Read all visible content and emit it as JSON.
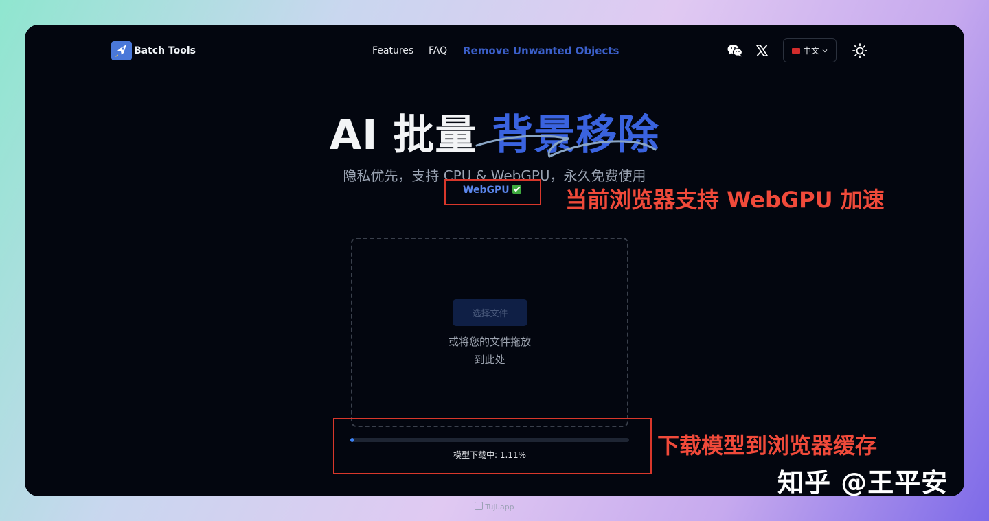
{
  "header": {
    "brand": "Batch Tools",
    "nav": [
      {
        "label": "Features"
      },
      {
        "label": "FAQ"
      },
      {
        "label": "Remove Unwanted Objects"
      }
    ],
    "language_label": "中文"
  },
  "hero": {
    "title_main": "AI 批量 ",
    "title_accent": "背景移除",
    "subtitle": "隐私优先，支持 CPU & WebGPU，永久免费使用",
    "webgpu_status": "WebGPU"
  },
  "dropzone": {
    "button_label": "选择文件",
    "hint_line1": "或将您的文件拖放",
    "hint_line2": "到此处"
  },
  "progress": {
    "label": "模型下载中: 1.11%",
    "percent": 1.11
  },
  "annotations": {
    "webgpu_note": "当前浏览器支持 WebGPU 加速",
    "download_note": "下载模型到浏览器缓存"
  },
  "watermark": "知乎 @王平安",
  "footer_credit": "Tuji.app",
  "colors": {
    "accent": "#3a63df",
    "annotation": "#d8372b",
    "background": "#03060f"
  }
}
